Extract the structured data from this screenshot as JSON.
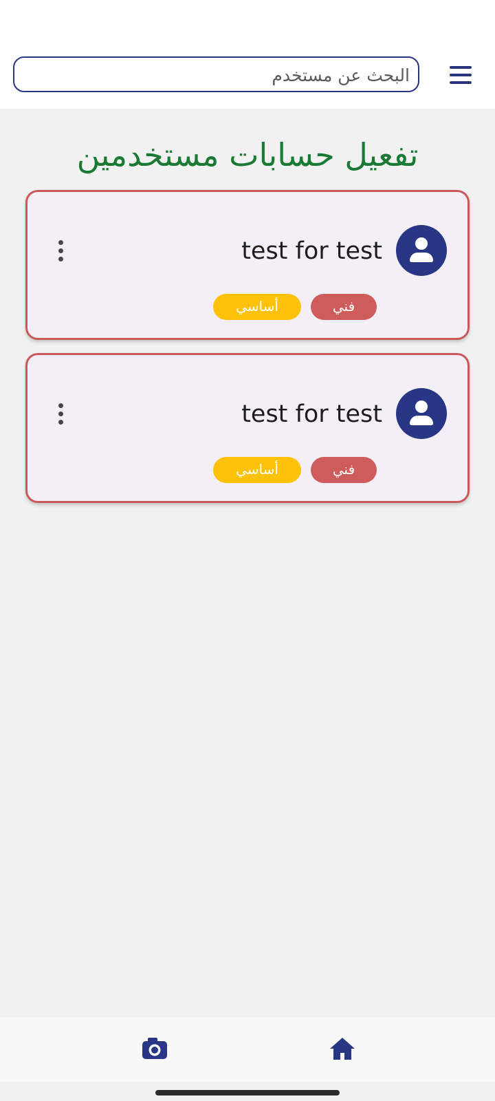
{
  "header": {
    "search": {
      "placeholder": "البحث عن مستخدم",
      "value": ""
    },
    "menu_icon": "hamburger-menu-icon"
  },
  "page": {
    "title": "تفعيل حسابات مستخدمين"
  },
  "users": [
    {
      "name": "test for test",
      "tags": [
        "فني",
        "أساسي"
      ],
      "avatar_icon": "person-icon"
    },
    {
      "name": "test for test",
      "tags": [
        "فني",
        "أساسي"
      ],
      "avatar_icon": "person-icon"
    }
  ],
  "bottom_nav": {
    "items": [
      "camera-icon",
      "home-icon"
    ]
  },
  "colors": {
    "primary": "#283685",
    "title_green": "#1a7a34",
    "card_border": "#c95959",
    "tag_red": "#cf5c5c",
    "tag_yellow": "#fdc107",
    "card_bg": "#f4eff6",
    "page_bg": "#f1f1f2"
  }
}
